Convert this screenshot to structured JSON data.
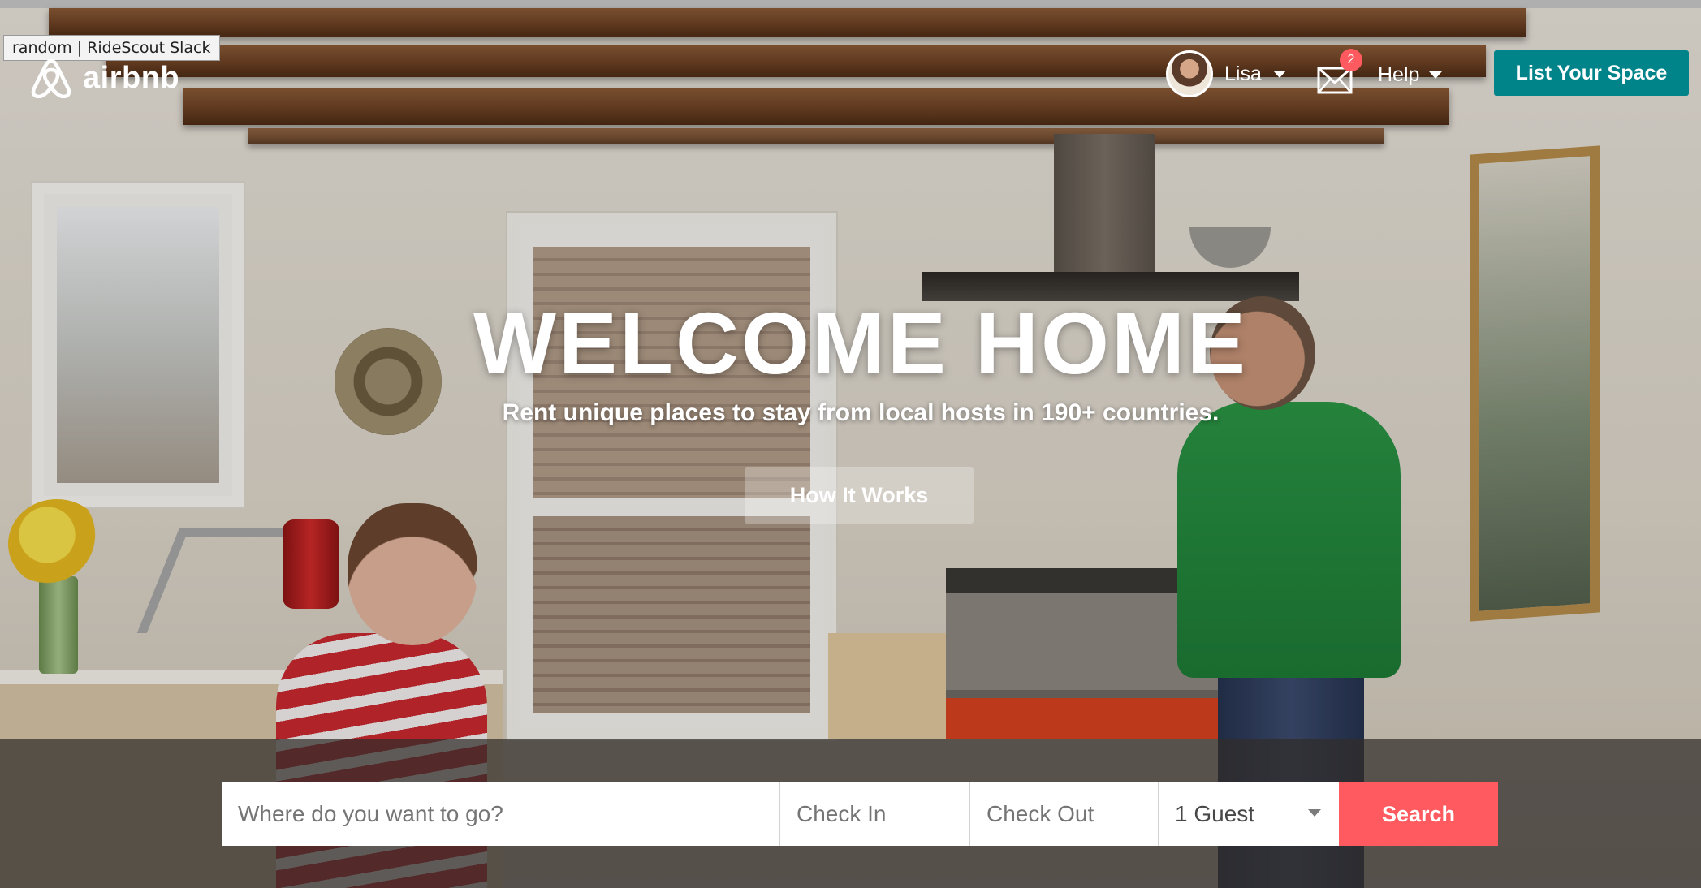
{
  "browser_tooltip": "random | RideScout Slack",
  "brand": {
    "logo_text": "airbnb",
    "accent_color": "#ff5a5f",
    "teal_color": "#00848a"
  },
  "header": {
    "user_name": "Lisa",
    "messages_count": "2",
    "help_label": "Help",
    "list_space_label": "List Your Space"
  },
  "hero": {
    "title": "WELCOME HOME",
    "subtitle": "Rent unique places to stay from local hosts in 190+ countries.",
    "how_it_works_label": "How It Works"
  },
  "search": {
    "where_placeholder": "Where do you want to go?",
    "checkin_placeholder": "Check In",
    "checkout_placeholder": "Check Out",
    "guests_value": "1 Guest",
    "search_label": "Search"
  },
  "icons": {
    "logo": "airbnb-belo-icon",
    "messages": "envelope-icon",
    "dropdown": "caret-down-icon"
  }
}
